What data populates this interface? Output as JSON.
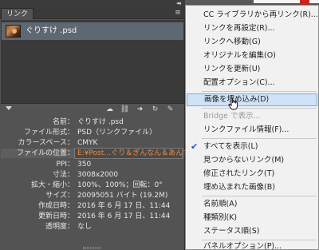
{
  "panel": {
    "collapse_glyph": "◂◂",
    "close_glyph": "✕",
    "tab_label": "リンク",
    "tab_close": "✕",
    "menu_glyph": "≡"
  },
  "links": [
    {
      "name": "ぐりすけ .psd"
    }
  ],
  "toolbar": {
    "tools": [
      {
        "icon": "creative-cloud-icon",
        "glyph": "☁"
      },
      {
        "icon": "relink-icon",
        "glyph": "⛓"
      },
      {
        "icon": "go-to-link-icon",
        "glyph": "➜"
      },
      {
        "icon": "update-link-icon",
        "glyph": "↻"
      },
      {
        "icon": "edit-original-icon",
        "glyph": "✎"
      }
    ]
  },
  "info": {
    "rows": [
      {
        "key": "名前：",
        "value": "ぐりすけ .psd",
        "orange": false
      },
      {
        "key": "ファイル形式：",
        "value": "PSD（リンクファイル）",
        "orange": false
      },
      {
        "key": "カラースペース：",
        "value": "CMYK",
        "orange": false
      },
      {
        "key": "ファイルの位置：",
        "value": "E:¥Post…ぐり＆ぎんなん＆あんず",
        "orange": true
      },
      {
        "key": "PPI：",
        "value": "350",
        "orange": false
      },
      {
        "key": "寸法：",
        "value": "3008x2000",
        "orange": false
      },
      {
        "key": "拡大・縮小：",
        "value": "100%、100%；回転：0°",
        "orange": false
      },
      {
        "key": "サイズ：",
        "value": "20095051 バイト (19.2M)",
        "orange": false
      },
      {
        "key": "作成日時：",
        "value": "2016 年 6 月 17 日、11:44",
        "orange": false
      },
      {
        "key": "更新日時：",
        "value": "2016 年 6 月 17 日、11:44",
        "orange": false
      },
      {
        "key": "透明度：",
        "value": "なし",
        "orange": false
      }
    ]
  },
  "menu": {
    "items": [
      {
        "label": "CC ライブラリから再リンク(R)...",
        "disabled": false,
        "checked": false,
        "hovered": false
      },
      {
        "label": "リンクを再設定(R)...",
        "disabled": false,
        "checked": false,
        "hovered": false
      },
      {
        "label": "リンクへ移動(G)",
        "disabled": false,
        "checked": false,
        "hovered": false
      },
      {
        "label": "オリジナルを編集(O)",
        "disabled": false,
        "checked": false,
        "hovered": false
      },
      {
        "label": "リンクを更新(U)",
        "disabled": false,
        "checked": false,
        "hovered": false
      },
      {
        "label": "配置オプション(C)...",
        "disabled": false,
        "checked": false,
        "hovered": false
      },
      {
        "label": "画像を埋め込み(D)",
        "disabled": false,
        "checked": false,
        "hovered": true
      },
      {
        "label": "Bridge で表示...",
        "disabled": true,
        "checked": false,
        "hovered": false
      },
      {
        "label": "リンクファイル情報(F)...",
        "disabled": false,
        "checked": false,
        "hovered": false
      },
      {
        "label": "すべてを表示(L)",
        "disabled": false,
        "checked": true,
        "hovered": false
      },
      {
        "label": "見つからないリンク(M)",
        "disabled": false,
        "checked": false,
        "hovered": false
      },
      {
        "label": "修正されたリンク(T)",
        "disabled": false,
        "checked": false,
        "hovered": false
      },
      {
        "label": "埋め込まれた画像(B)",
        "disabled": false,
        "checked": false,
        "hovered": false
      },
      {
        "label": "名前順(A)",
        "disabled": false,
        "checked": false,
        "hovered": false
      },
      {
        "label": "種類別(K)",
        "disabled": false,
        "checked": false,
        "hovered": false
      },
      {
        "label": "ステータス順(S)",
        "disabled": false,
        "checked": false,
        "hovered": false
      },
      {
        "label": "パネルオプション(P)...",
        "disabled": false,
        "checked": false,
        "hovered": false
      }
    ],
    "check_glyph": "✔"
  }
}
